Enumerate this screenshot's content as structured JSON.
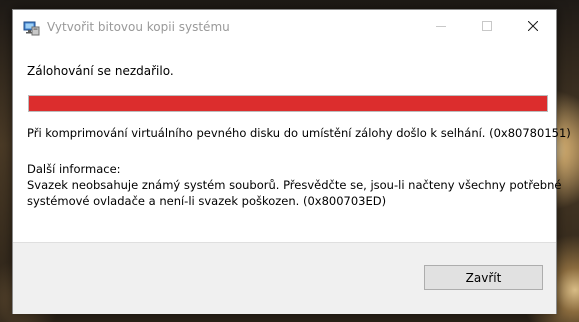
{
  "window": {
    "title": "Vytvořit bitovou kopii systému",
    "icon": "system-image-backup-icon"
  },
  "titlebar_buttons": {
    "minimize_icon": "minimize-icon",
    "maximize_icon": "maximize-icon",
    "close_icon": "close-icon"
  },
  "main": {
    "status": "Zálohování se nezdařilo.",
    "progress": {
      "value_percent": 100,
      "color": "#dc2d2d"
    },
    "error_message": "Při komprimování virtuálního pevného disku do umístění zálohy došlo k selhání. (0x80780151)",
    "details_heading": "Další informace:",
    "details_lines": [
      "Svazek neobsahuje známý systém souborů.  Přesvědčte se, jsou-li načteny všechny potřebné",
      "systémové ovladače a není-li svazek poškozen. (0x800703ED)"
    ]
  },
  "footer": {
    "close_button_label": "Zavřít"
  }
}
